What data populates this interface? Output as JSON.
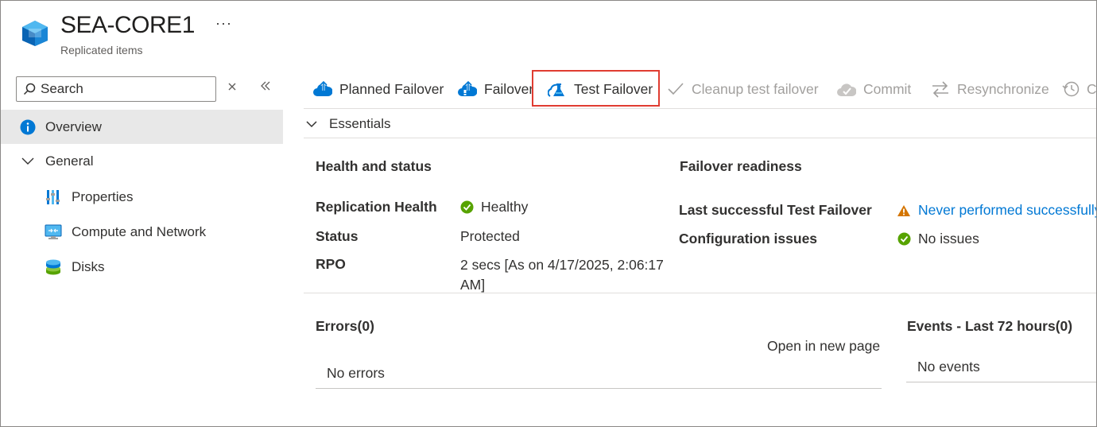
{
  "header": {
    "title": "SEA-CORE1",
    "subtitle": "Replicated items",
    "more": "···"
  },
  "nav": {
    "search_placeholder": "Search",
    "items": {
      "overview": "Overview",
      "general": "General",
      "properties": "Properties",
      "compute": "Compute and Network",
      "disks": "Disks"
    }
  },
  "toolbar": {
    "planned_failover": "Planned Failover",
    "failover": "Failover",
    "test_failover": "Test Failover",
    "cleanup": "Cleanup test failover",
    "commit": "Commit",
    "resync": "Resynchronize",
    "change_recovery": "C"
  },
  "essentials": {
    "toggle_label": "Essentials",
    "health": {
      "title": "Health and status",
      "replication_health_label": "Replication Health",
      "replication_health_value": "Healthy",
      "status_label": "Status",
      "status_value": "Protected",
      "rpo_label": "RPO",
      "rpo_value": "2 secs [As on 4/17/2025, 2:06:17 AM]"
    },
    "readiness": {
      "title": "Failover readiness",
      "last_test_label": "Last successful Test Failover",
      "last_test_value": "Never performed successfully",
      "config_label": "Configuration issues",
      "config_value": "No issues"
    }
  },
  "errors": {
    "title": "Errors(0)",
    "open_link": "Open in new page",
    "empty": "No errors"
  },
  "events": {
    "title": "Events - Last 72 hours(0)",
    "empty": "No events"
  },
  "colors": {
    "accent": "#0078d4",
    "success": "#57a300",
    "warning": "#d47500",
    "highlight": "#e03c31"
  }
}
